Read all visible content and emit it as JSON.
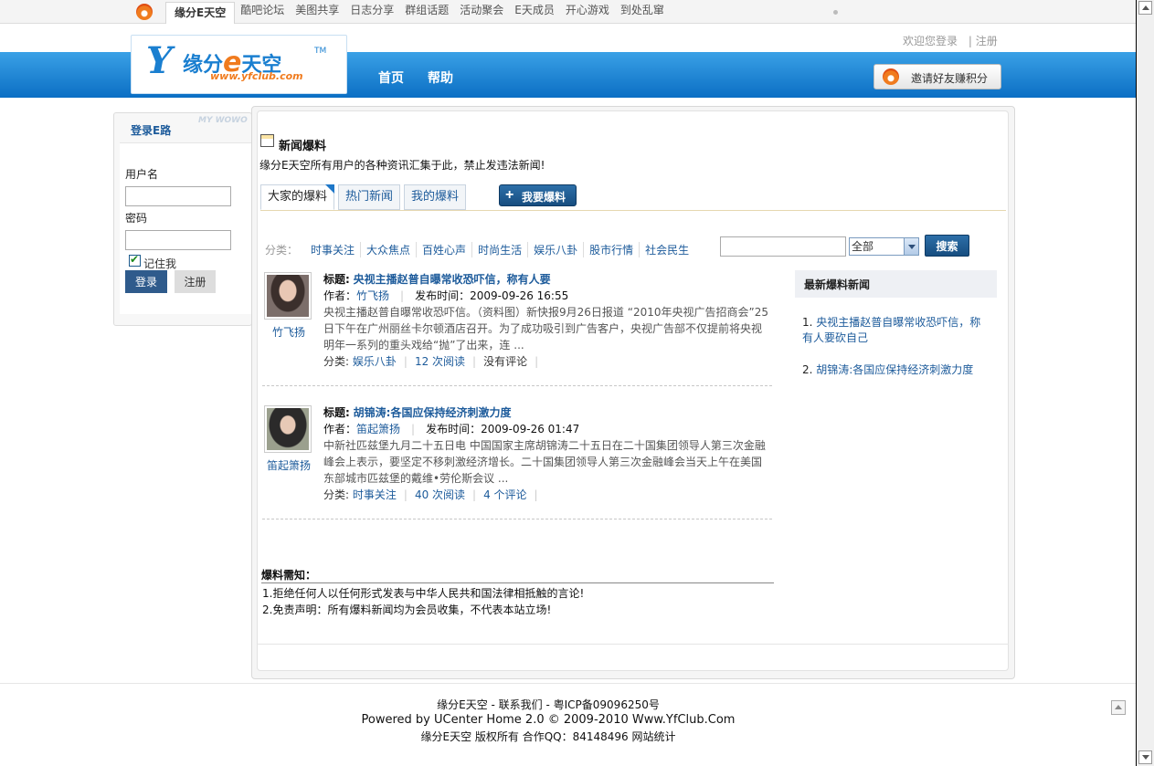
{
  "topnav": {
    "tabs": [
      "缘分E天空",
      "酷吧论坛",
      "美图共享",
      "日志分享",
      "群组话题",
      "活动聚会",
      "E天成员",
      "开心游戏",
      "到处乱窜"
    ]
  },
  "header": {
    "login_text": "欢迎您登录",
    "register_link": "| 注册",
    "logo_main": "缘分",
    "logo_e": "e",
    "logo_sky": "天空",
    "logo_tm": "TM",
    "logo_url": "www.yfclub.com",
    "nav": [
      "首页",
      "帮助"
    ],
    "invite_button": "邀请好友赚积分"
  },
  "login_panel": {
    "title": "登录E路",
    "deco": "MY WOWO",
    "username_label": "用户名",
    "password_label": "密码",
    "remember_label": "记住我",
    "remember_checked": true,
    "login_button": "登录",
    "register_button": "注册"
  },
  "page": {
    "title": "新闻爆料",
    "description": "缘分E天空所有用户的各种资讯汇集于此，禁止发违法新闻!",
    "tabs": [
      "大家的爆料",
      "热门新闻",
      "我的爆料"
    ],
    "post_button": "我要爆料"
  },
  "filter": {
    "label": "分类：",
    "categories": [
      "时事关注",
      "大众焦点",
      "百姓心声",
      "时尚生活",
      "娱乐八卦",
      "股市行情",
      "社会民生"
    ],
    "select_value": "全部",
    "search_button": "搜索"
  },
  "news": [
    {
      "avatar_name": "竹飞扬",
      "title_label": "标题:",
      "title": "央视主播赵普自曝常收恐吓信，称有人要",
      "author_label": "作者：",
      "author": "竹飞扬",
      "time_label": "发布时间：",
      "time": "2009-09-26 16:55",
      "summary": "央视主播赵普自曝常收恐吓信。（资料图）新快报9月26日报道 “2010年央视广告招商会”25日下午在广州丽丝卡尔顿酒店召开。为了成功吸引到广告客户，央视广告部不仅提前将央视明年一系列的重头戏给“抛”了出来，连 ...",
      "cat_label": "分类:",
      "category": "娱乐八卦",
      "reads": "12 次阅读",
      "comments": "没有评论"
    },
    {
      "avatar_name": "笛起箫扬",
      "title_label": "标题:",
      "title": "胡锦涛:各国应保持经济刺激力度",
      "author_label": "作者：",
      "author": "笛起箫扬",
      "time_label": "发布时间：",
      "time": "2009-09-26 01:47",
      "summary": "中新社匹兹堡九月二十五日电 中国国家主席胡锦涛二十五日在二十国集团领导人第三次金融峰会上表示，要坚定不移刺激经济增长。二十国集团领导人第三次金融峰会当天上午在美国东部城市匹兹堡的戴维•劳伦斯会议 ...",
      "cat_label": "分类:",
      "category": "时事关注",
      "reads": "40 次阅读",
      "comments": "4 个评论"
    }
  ],
  "sidebar": {
    "title": "最新爆料新闻",
    "items": [
      {
        "num": "1. ",
        "text": "央视主播赵普自曝常收恐吓信，称有人要砍自己"
      },
      {
        "num": "2. ",
        "text": "胡锦涛:各国应保持经济刺激力度"
      }
    ]
  },
  "notice": {
    "title": "爆料需知：",
    "lines": [
      "1.拒绝任何人以任何形式发表与中华人民共和国法律相抵触的言论!",
      "2.免责声明：所有爆料新闻均为会员收集，不代表本站立场!"
    ]
  },
  "footer": {
    "line1": "缘分E天空 - 联系我们 - 粤ICP备09096250号",
    "line2": "Powered by UCenter Home 2.0 © 2009-2010 Www.YfClub.Com",
    "line3": "缘分E天空 版权所有 合作QQ：84148496 网站统计"
  }
}
